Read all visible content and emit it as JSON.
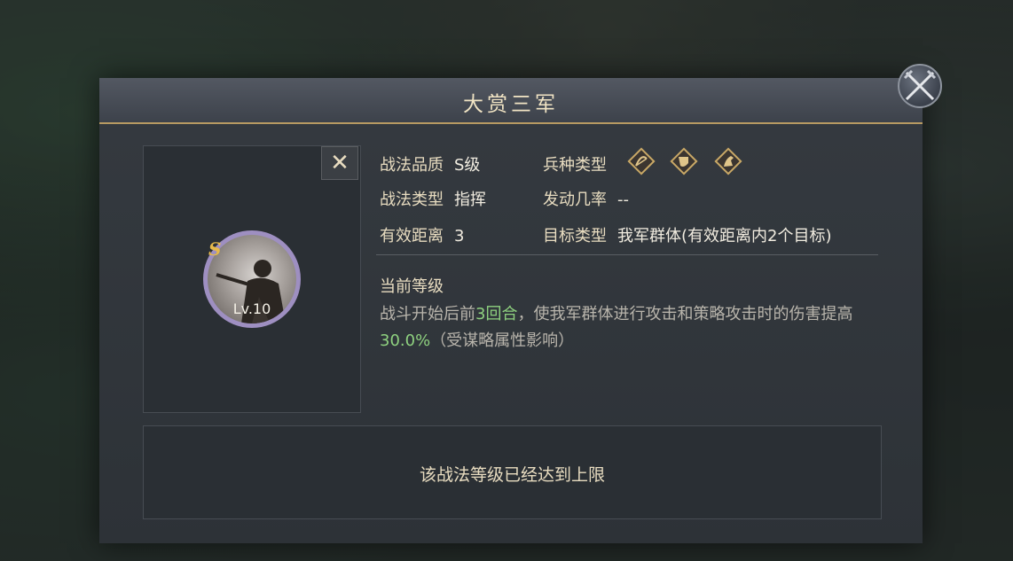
{
  "dialog": {
    "title": "大赏三军"
  },
  "skill": {
    "grade_badge": "S",
    "level": "Lv.10"
  },
  "info": {
    "quality_label": "战法品质",
    "quality_value": "S级",
    "type_label": "战法类型",
    "type_value": "指挥",
    "range_label": "有效距离",
    "range_value": "3",
    "troop_label": "兵种类型",
    "troop_icons": [
      "bow-icon",
      "shield-icon",
      "horse-icon"
    ],
    "chance_label": "发动几率",
    "chance_value": "--",
    "target_label": "目标类型",
    "target_value": "我军群体(有效距离内2个目标)"
  },
  "current": {
    "title": "当前等级",
    "desc_part1": "战斗开始后前",
    "desc_hl1": "3回合",
    "desc_part2": "，使我军群体进行攻击和策略攻击时的伤害提高",
    "desc_hl2": "30.0%",
    "desc_part3": "（受谋略属性影响）"
  },
  "footer": {
    "max_text": "该战法等级已经达到上限"
  },
  "colors": {
    "accent_gold": "#e8dcc0",
    "highlight_green": "#8ed17f",
    "ring_purple": "#9e8fc1"
  }
}
